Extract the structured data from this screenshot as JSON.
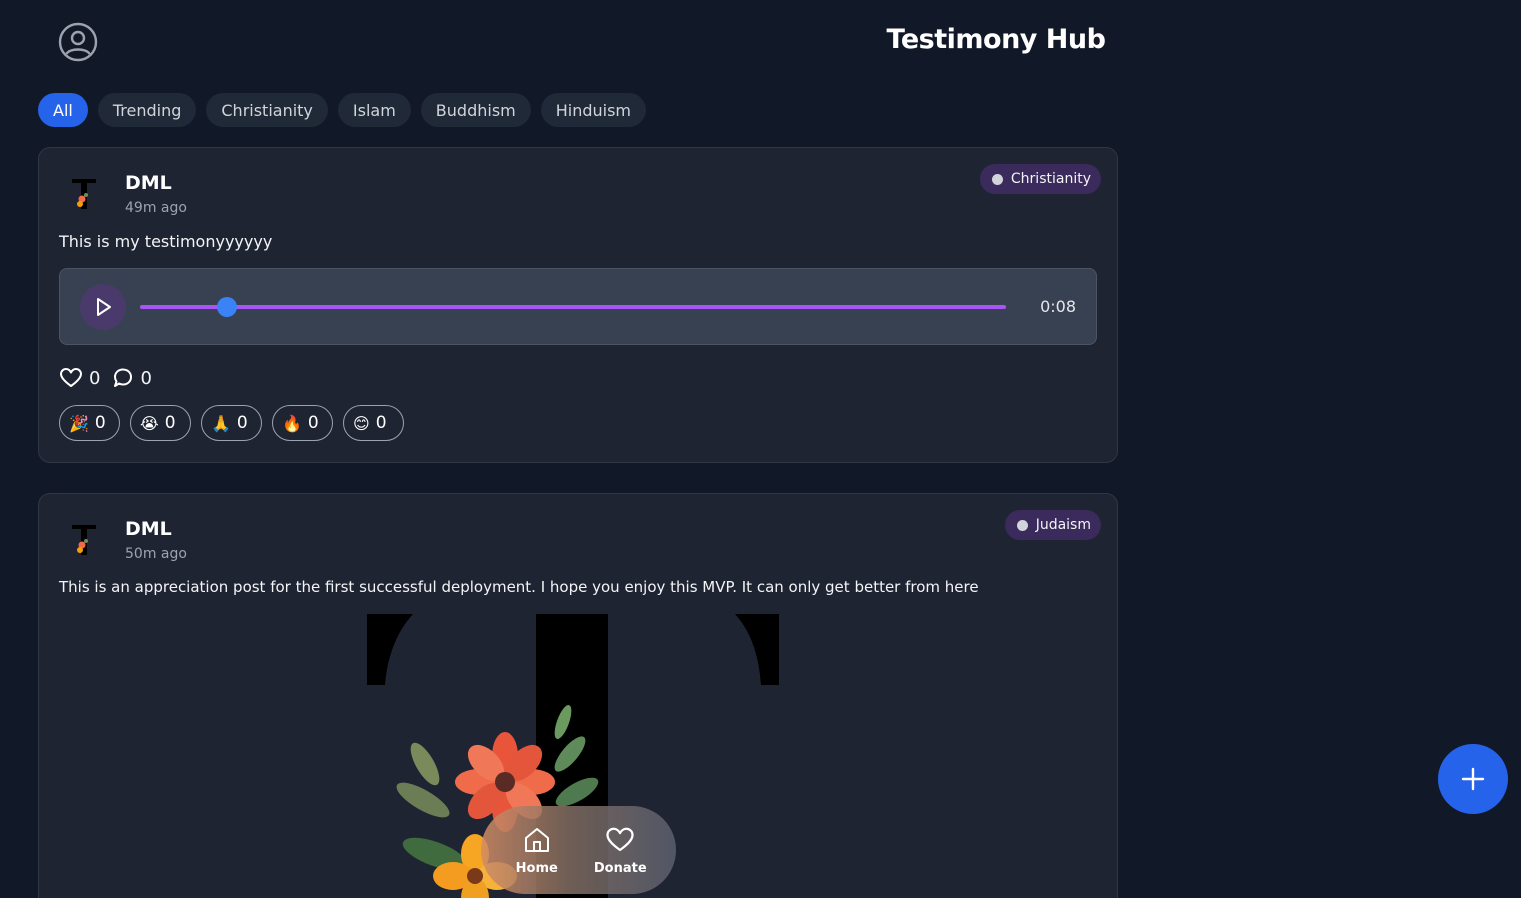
{
  "header": {
    "title": "Testimony Hub",
    "profile_icon": "user-circle-icon"
  },
  "filters": [
    {
      "label": "All",
      "active": true
    },
    {
      "label": "Trending",
      "active": false
    },
    {
      "label": "Christianity",
      "active": false
    },
    {
      "label": "Islam",
      "active": false
    },
    {
      "label": "Buddhism",
      "active": false
    },
    {
      "label": "Hinduism",
      "active": false
    }
  ],
  "posts": [
    {
      "author": "DML",
      "time": "49m ago",
      "tag": "Christianity",
      "text": "This is my testimonyyyyyy",
      "audio": {
        "duration": "0:08",
        "progress": 0.1
      },
      "likes": "0",
      "comments": "0",
      "reactions": [
        {
          "emoji": "🎉",
          "count": "0"
        },
        {
          "emoji": "😭",
          "count": "0"
        },
        {
          "emoji": "🙏",
          "count": "0"
        },
        {
          "emoji": "🔥",
          "count": "0"
        },
        {
          "emoji": "😊",
          "count": "0"
        }
      ]
    },
    {
      "author": "DML",
      "time": "50m ago",
      "tag": "Judaism",
      "text": "This is an appreciation post for the first successful deployment. I hope you enjoy this MVP. It can only get better from here"
    }
  ],
  "bottom_nav": {
    "home_label": "Home",
    "donate_label": "Donate"
  },
  "colors": {
    "background": "#111827",
    "card": "#1f2433",
    "accent": "#2563eb",
    "audio_track": "#a855f7",
    "tag_bg": "#3b2a5c"
  }
}
